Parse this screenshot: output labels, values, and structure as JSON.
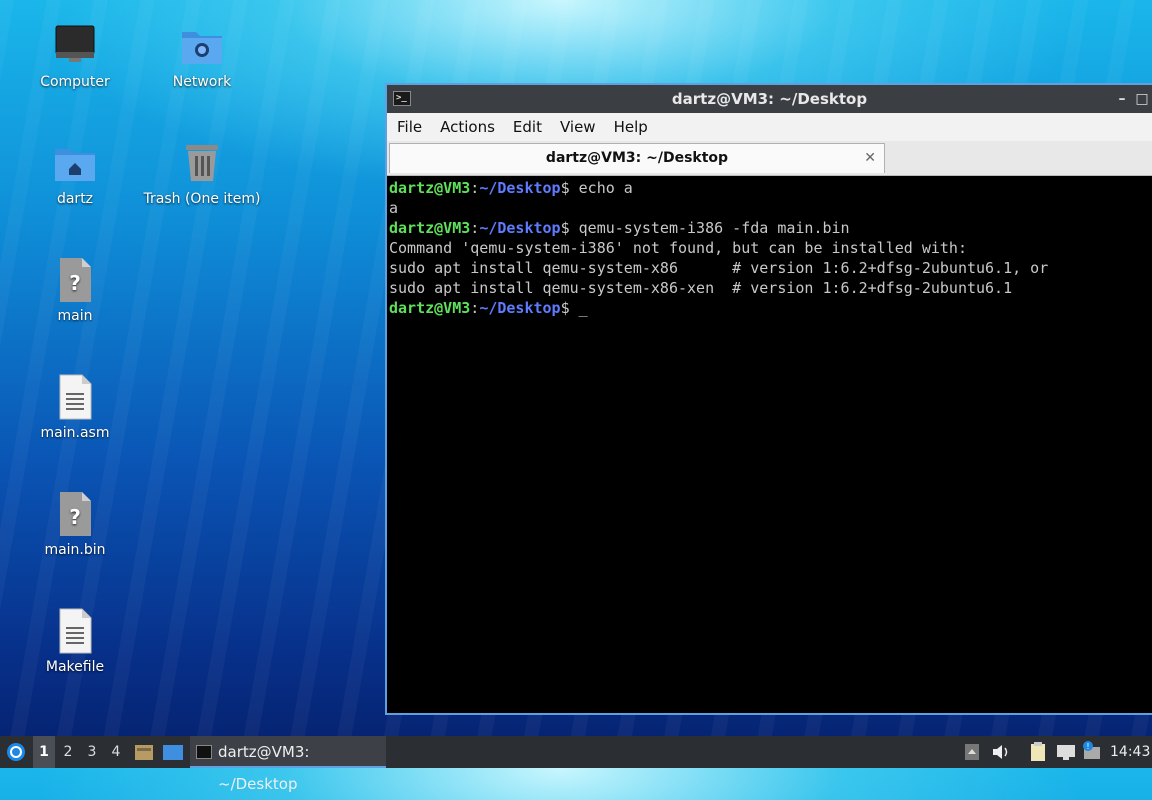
{
  "desktop": {
    "icons": [
      {
        "label": "Computer"
      },
      {
        "label": "Network"
      },
      {
        "label": "dartz"
      },
      {
        "label": "Trash (One item)"
      },
      {
        "label": "main"
      },
      {
        "label": "main.asm"
      },
      {
        "label": "main.bin"
      },
      {
        "label": "Makefile"
      }
    ]
  },
  "window": {
    "title": "dartz@VM3: ~/Desktop",
    "menu": [
      "File",
      "Actions",
      "Edit",
      "View",
      "Help"
    ],
    "tab_title": "dartz@VM3: ~/Desktop",
    "terminal": {
      "user": "dartz@VM3",
      "sep": ":",
      "path": "~/Desktop",
      "lines": [
        {
          "cmd": "$ echo a"
        },
        {
          "out": "a"
        },
        {
          "cmd": "$ qemu-system-i386 -fda main.bin"
        },
        {
          "out": "Command 'qemu-system-i386' not found, but can be installed with:"
        },
        {
          "out": "sudo apt install qemu-system-x86      # version 1:6.2+dfsg-2ubuntu6.1, or"
        },
        {
          "out": "sudo apt install qemu-system-x86-xen  # version 1:6.2+dfsg-2ubuntu6.1"
        },
        {
          "cmd": "$ _"
        }
      ]
    }
  },
  "taskbar": {
    "workspaces": [
      "1",
      "2",
      "3",
      "4"
    ],
    "task_label": "dartz@VM3: ~/Desktop",
    "clock": "14:43"
  },
  "colors": {
    "accent": "#5ea0e0",
    "prompt_user": "#5fe05a",
    "prompt_path": "#5f7bff"
  }
}
